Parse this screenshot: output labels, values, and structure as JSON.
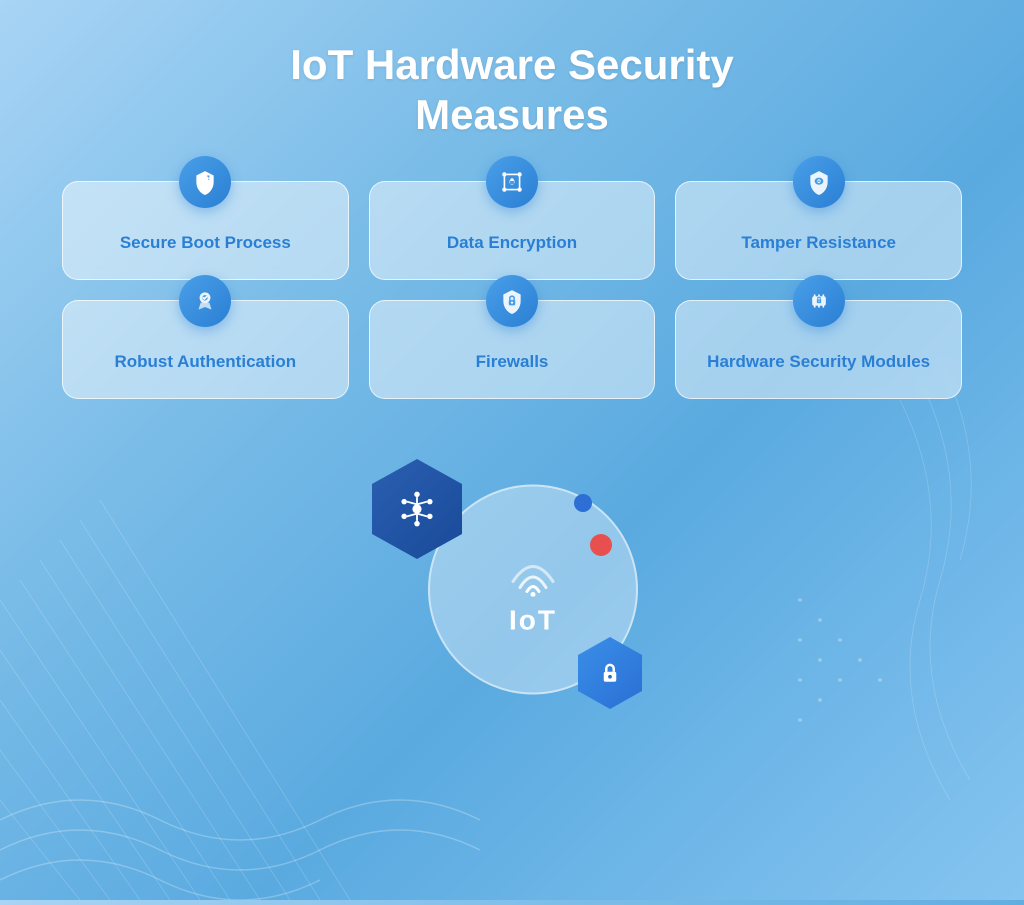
{
  "page": {
    "title_line1": "IoT Hardware Security",
    "title_line2": "Measures"
  },
  "cards": [
    {
      "id": "secure-boot",
      "label": "Secure Boot Process",
      "icon": "shield-chip"
    },
    {
      "id": "data-encryption",
      "label": "Data Encryption",
      "icon": "lock-network"
    },
    {
      "id": "tamper-resistance",
      "label": "Tamper Resistance",
      "icon": "shield-eye"
    },
    {
      "id": "robust-auth",
      "label": "Robust Authentication",
      "icon": "medal"
    },
    {
      "id": "firewalls",
      "label": "Firewalls",
      "icon": "shield-lock"
    },
    {
      "id": "hsm",
      "label": "Hardware Security Modules",
      "icon": "chip-lock"
    }
  ],
  "illustration": {
    "iot_label": "IoT",
    "colors": {
      "accent_blue": "#2a6fd4",
      "dot_blue": "#2d6fd4",
      "dot_red": "#e85050"
    }
  }
}
